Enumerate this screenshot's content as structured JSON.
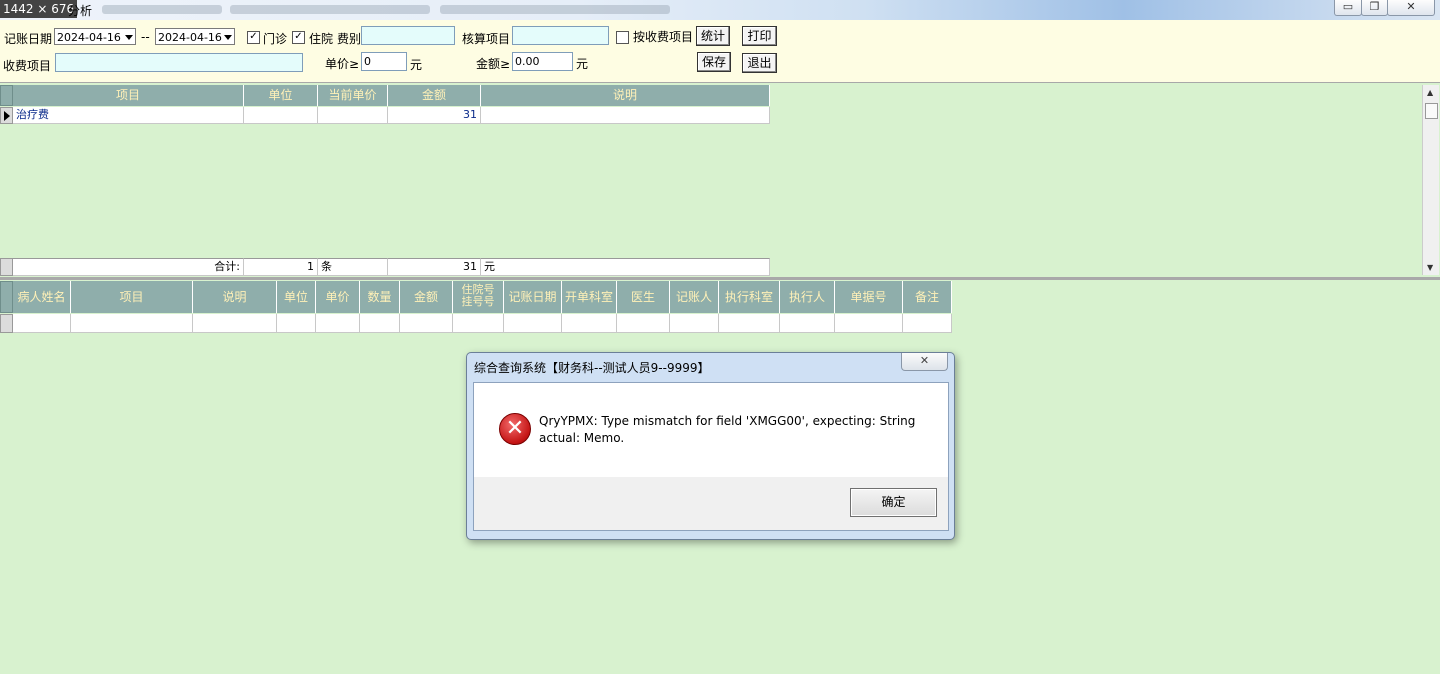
{
  "window": {
    "size_badge": "1442 × 676",
    "title_suffix": "分析",
    "minimize_icon": "▭",
    "restore_icon": "❐",
    "close_icon": "✕"
  },
  "toolbar": {
    "date_label": "记账日期",
    "date_from": "2024-04-16",
    "date_sep": "--",
    "date_to": "2024-04-16",
    "outpatient_label": "门诊",
    "outpatient_checked": true,
    "inpatient_label": "住院",
    "inpatient_checked": true,
    "fee_type_label": "费别",
    "fee_type_value": "",
    "account_item_label": "核算项目",
    "account_item_value": "",
    "by_charge_item_label": "按收费项目",
    "by_charge_item_checked": false,
    "stats_button": "统计",
    "print_button": "打印",
    "charge_item_label": "收费项目",
    "charge_item_value": "",
    "unit_price_label": "单价≥",
    "unit_price_value": "0",
    "unit_price_unit": "元",
    "amount_label": "金额≥",
    "amount_value": "0.00",
    "amount_unit": "元",
    "save_button": "保存",
    "exit_button": "退出"
  },
  "summary_grid": {
    "headers": [
      "项目",
      "单位",
      "当前单价",
      "金额",
      "说明"
    ],
    "rows": [
      {
        "item": "治疗费",
        "unit": "",
        "price": "",
        "amount": "31",
        "note": ""
      }
    ],
    "total_label": "合计:",
    "total_count": "1",
    "total_count_unit": "条",
    "total_amount": "31",
    "total_amount_unit": "元"
  },
  "detail_grid": {
    "headers": [
      "病人姓名",
      "项目",
      "说明",
      "单位",
      "单价",
      "数量",
      "金额",
      "住院号\n挂号号",
      "记账日期",
      "开单科室",
      "医生",
      "记账人",
      "执行科室",
      "执行人",
      "单据号",
      "备注"
    ],
    "header_two_line_top": "住院号",
    "header_two_line_bottom": "挂号号"
  },
  "dialog": {
    "title": "综合查询系统【财务科--测试人员9--9999】",
    "close_icon": "✕",
    "error_icon": "✕",
    "message_line1": "QryYPMX: Type mismatch for field 'XMGG00', expecting: String",
    "message_line2": "actual: Memo.",
    "ok_button": "确定"
  }
}
